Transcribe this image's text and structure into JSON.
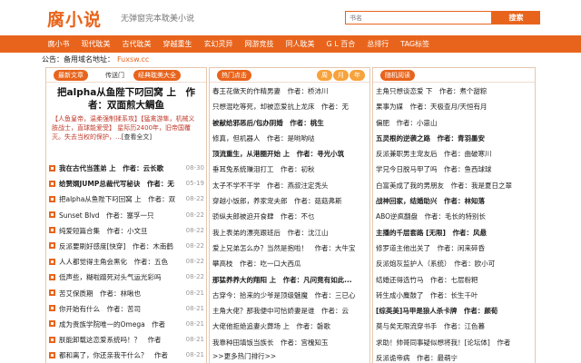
{
  "header": {
    "logo": "腐小说",
    "slogan": "无弹窗完本耽美小说",
    "search_placeholder": "书名",
    "search_button": "搜索"
  },
  "nav": [
    "腐小书",
    "现代耽美",
    "古代耽美",
    "穿越重生",
    "玄幻灵异",
    "网游竞技",
    "同人耽美",
    "G L 百合",
    "总排行",
    "TAG标签"
  ],
  "notice": {
    "label": "公告：备用域名地址：",
    "url": "Fuxsw.cc"
  },
  "left": {
    "tabs": [
      "最新文章",
      "传送门",
      "经典耽美大全"
    ],
    "feature_title": "把alpha从鱼陛下叼回窝 上　作者：双面煎大鲷鱼",
    "feature_desc": "【人鱼皇帝，温柔强制揉系攻】【猛禽游隼，机械义肢战士，直球能爱受】 星际历2400年，旧帝国覆灭。失去当权的保护，...",
    "feature_link": "[查看全文]",
    "items": [
      {
        "title": "我在古代当莲弟 上　作者：云长歌",
        "date": "08-30",
        "bold": true
      },
      {
        "title": "给赘婿JUMP总裁代写秘诀　作者：无",
        "date": "05-19",
        "bold": true
      },
      {
        "title": "把alpha从鱼陛下叼回窝 上　作者：双",
        "date": "08-22",
        "bold": false
      },
      {
        "title": "Sunset Blvd　作者：塞孚一只",
        "date": "08-22",
        "bold": false
      },
      {
        "title": "纯爱短篇合集　作者：小文旦",
        "date": "08-22",
        "bold": false
      },
      {
        "title": "反派要刷好感度[快穿]　作者：木南鹤",
        "date": "08-22",
        "bold": false
      },
      {
        "title": "人人都觉得主角会黑化　作者：五色",
        "date": "08-22",
        "bold": false
      },
      {
        "title": "低声些，糊啦蹭死对头气运光彩吗",
        "date": "08-22",
        "bold": false
      },
      {
        "title": "苦艾保质期　作者：林啾也",
        "date": "08-21",
        "bold": false
      },
      {
        "title": "你开始有什么　作者：苦司",
        "date": "08-21",
        "bold": false
      },
      {
        "title": "成为贵族学院唯一的Omega　作者",
        "date": "08-21",
        "bold": false
      },
      {
        "title": "朕能卸载这恋爱系统吗！？　作者",
        "date": "08-21",
        "bold": false
      },
      {
        "title": "都和离了，你还亲我干什么？　作者",
        "date": "08-21",
        "bold": false
      }
    ]
  },
  "mid": {
    "tabs": [
      "热门点击",
      "周",
      "月",
      "年"
    ],
    "items": [
      {
        "title": "春王花做天的作精男妻　作者：桥沛川",
        "bold": false
      },
      {
        "title": "只想混吃等死，却被恋爱抗上龙床　作者：无",
        "bold": false
      },
      {
        "title": "被献给邪恶后/包办阴婚　作者：桃生",
        "bold": true
      },
      {
        "title": "修真，但机器人　作者：是哟哟哒",
        "bold": false
      },
      {
        "title": "顶流重生，从港圈开始 上　作者：寻光小筑",
        "bold": true
      },
      {
        "title": "垂耳兔系统赚泪打工　作者：初秋",
        "bold": false
      },
      {
        "title": "太子不学不干学　作者：燕叔注定秃头",
        "bold": false
      },
      {
        "title": "穿越小饭郎，养家宠夫郎　作者：菇菇弗斯",
        "bold": false
      },
      {
        "title": "骄纵夫郎被迫开食肆　作者：不乜",
        "bold": false
      },
      {
        "title": "我上表弟的漂亮跟班后　作者：沈江山",
        "bold": false
      },
      {
        "title": "爱上兄弟怎么办？当然是抱啦！　作者：大牛宝",
        "bold": false
      },
      {
        "title": "攀高枝　作者：吃一口大西瓜",
        "bold": false
      },
      {
        "title": "那猛养养大的翔阳 上　作者：凡问竟有如此...",
        "bold": true
      },
      {
        "title": "古穿今：拾来的少爷是顶级魅魔　作者：三已心",
        "bold": false
      },
      {
        "title": "主角大佬？那我便中可恰娇妻是谁　作者：云",
        "bold": false
      },
      {
        "title": "大佬他拒绝追妻火葬场 上　作者：磐歌",
        "bold": false
      },
      {
        "title": "我靠种田填饭当族长　作者：宫槐知玉",
        "bold": false
      }
    ],
    "more": ">>更多热门排行>>"
  },
  "right": {
    "tabs": [
      "随机阅读"
    ],
    "items": [
      {
        "title": "主角只想谈恋爱 下　作者：煮个甜粽",
        "bold": false
      },
      {
        "title": "果事为媒　作者：天极查月/天恒有月",
        "bold": false
      },
      {
        "title": "偏肥　作者：小崽山",
        "bold": false
      },
      {
        "title": "五灵根的逆袭之路　作者：青羽墨安",
        "bold": true
      },
      {
        "title": "反派兼职男主宠友后　作者：曲破寒川",
        "bold": false
      },
      {
        "title": "学兄今日脱马甲了吗　作者：鱼西球球",
        "bold": false
      },
      {
        "title": "白富美成了我的男朋友　作者：我是夏日之翠",
        "bold": false
      },
      {
        "title": "战神回家，结婚助兴　作者：林知落",
        "bold": true
      },
      {
        "title": "ABO逆疯翻盘　作者：毛长的特别长",
        "bold": false
      },
      {
        "title": "主播的千层套路 [无限]　作者：风悬",
        "bold": true
      },
      {
        "title": "修罗道主他出关了　作者：闲来碎昏",
        "bold": false
      },
      {
        "title": "反派炮灰监护人（系统）　作者：欧小可",
        "bold": false
      },
      {
        "title": "结婚还得选竹马　作者：七层粉粑",
        "bold": false
      },
      {
        "title": "转生成小麋鼓了　作者：长生千叶",
        "bold": false
      },
      {
        "title": "[综英美]马甲是狼人杀卡牌　作者：颜荀",
        "bold": true
      },
      {
        "title": "莫与矣无限流穿书手　作者：江色暮",
        "bold": false
      },
      {
        "title": "求助！帅哥同事疑似想将我！[论坛体]　作者",
        "bold": false
      },
      {
        "title": "反派诡帝病　作者：最萌宁",
        "bold": false
      }
    ]
  },
  "colors": {
    "accent": "#e8641c",
    "tab_alt": "#f7a23b",
    "border": "#e5c8b0"
  }
}
